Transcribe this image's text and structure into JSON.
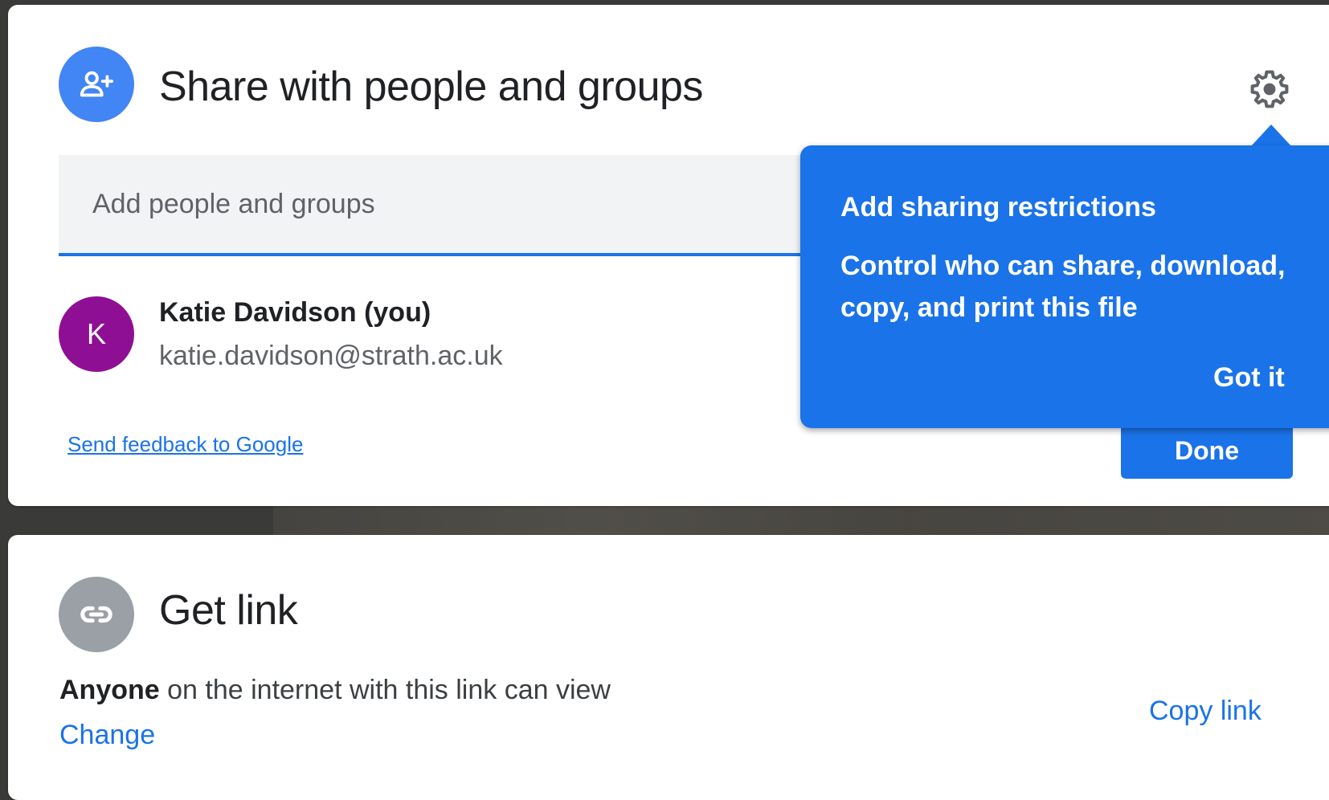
{
  "share": {
    "title": "Share with people and groups",
    "add_placeholder": "Add people and groups",
    "person": {
      "initial": "K",
      "name": "Katie Davidson (you)",
      "email": "katie.davidson@strath.ac.uk",
      "avatar_color": "#8e0f94"
    },
    "feedback_link": "Send feedback to Google",
    "done_label": "Done",
    "settings_icon": "gear-icon",
    "header_icon": "person-add-icon"
  },
  "tooltip": {
    "title": "Add sharing restrictions",
    "body": "Control who can share, download, copy, and print this file",
    "got_it_label": "Got it"
  },
  "link": {
    "title": "Get link",
    "header_icon": "link-icon",
    "access_strong": "Anyone",
    "access_rest": " on the internet with this link can view",
    "change_label": "Change",
    "copy_label": "Copy link"
  },
  "colors": {
    "accent": "#1a73e8",
    "share_icon_bg": "#4285f4",
    "link_icon_bg": "#9aa0a6"
  }
}
